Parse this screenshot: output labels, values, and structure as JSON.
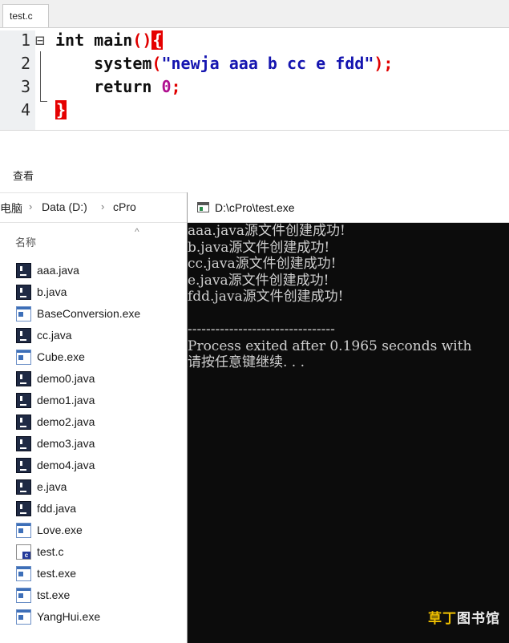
{
  "editor": {
    "tab_label": "test.c",
    "line_numbers": [
      "1",
      "2",
      "3",
      "4"
    ],
    "code": {
      "l1_kw": "int",
      "l1_name": " main",
      "l1_paren": "()",
      "l1_brace": "{",
      "l2_indent": "    ",
      "l2_func": "system",
      "l2_open": "(",
      "l2_str": "\"newja aaa b cc e fdd\"",
      "l2_close": ");",
      "l3_indent": "    ",
      "l3_kw": "return ",
      "l3_num": "0",
      "l3_semi": ";",
      "l4_brace": "}"
    }
  },
  "explorer": {
    "ribbon_tab": "查看",
    "breadcrumb": [
      "电脑",
      "Data (D:)",
      "cPro"
    ],
    "column_header": "名称",
    "files": [
      {
        "name": "aaa.java",
        "type": "java"
      },
      {
        "name": "b.java",
        "type": "java"
      },
      {
        "name": "BaseConversion.exe",
        "type": "exe"
      },
      {
        "name": "cc.java",
        "type": "java"
      },
      {
        "name": "Cube.exe",
        "type": "exe"
      },
      {
        "name": "demo0.java",
        "type": "java"
      },
      {
        "name": "demo1.java",
        "type": "java"
      },
      {
        "name": "demo2.java",
        "type": "java"
      },
      {
        "name": "demo3.java",
        "type": "java"
      },
      {
        "name": "demo4.java",
        "type": "java"
      },
      {
        "name": "e.java",
        "type": "java"
      },
      {
        "name": "fdd.java",
        "type": "java"
      },
      {
        "name": "Love.exe",
        "type": "exe"
      },
      {
        "name": "test.c",
        "type": "csrc"
      },
      {
        "name": "test.exe",
        "type": "exe"
      },
      {
        "name": "tst.exe",
        "type": "exe"
      },
      {
        "name": "YangHui.exe",
        "type": "exe"
      }
    ]
  },
  "console": {
    "title": "D:\\cPro\\test.exe",
    "lines": [
      "aaa.java源文件创建成功!",
      "b.java源文件创建成功!",
      "cc.java源文件创建成功!",
      "e.java源文件创建成功!",
      "fdd.java源文件创建成功!",
      "",
      "--------------------------------",
      "Process exited after 0.1965 seconds with",
      "请按任意键继续. . ."
    ]
  },
  "watermark": {
    "part1": "草丁",
    "part2": "图书馆"
  },
  "colors": {
    "brace_highlight": "#e50000",
    "string": "#1515b0",
    "number": "#b01090",
    "console_bg": "#0c0c0c"
  },
  "icons": {
    "java": "intellij-java-file-icon",
    "exe": "exe-window-icon",
    "csrc": "c-source-file-icon"
  }
}
